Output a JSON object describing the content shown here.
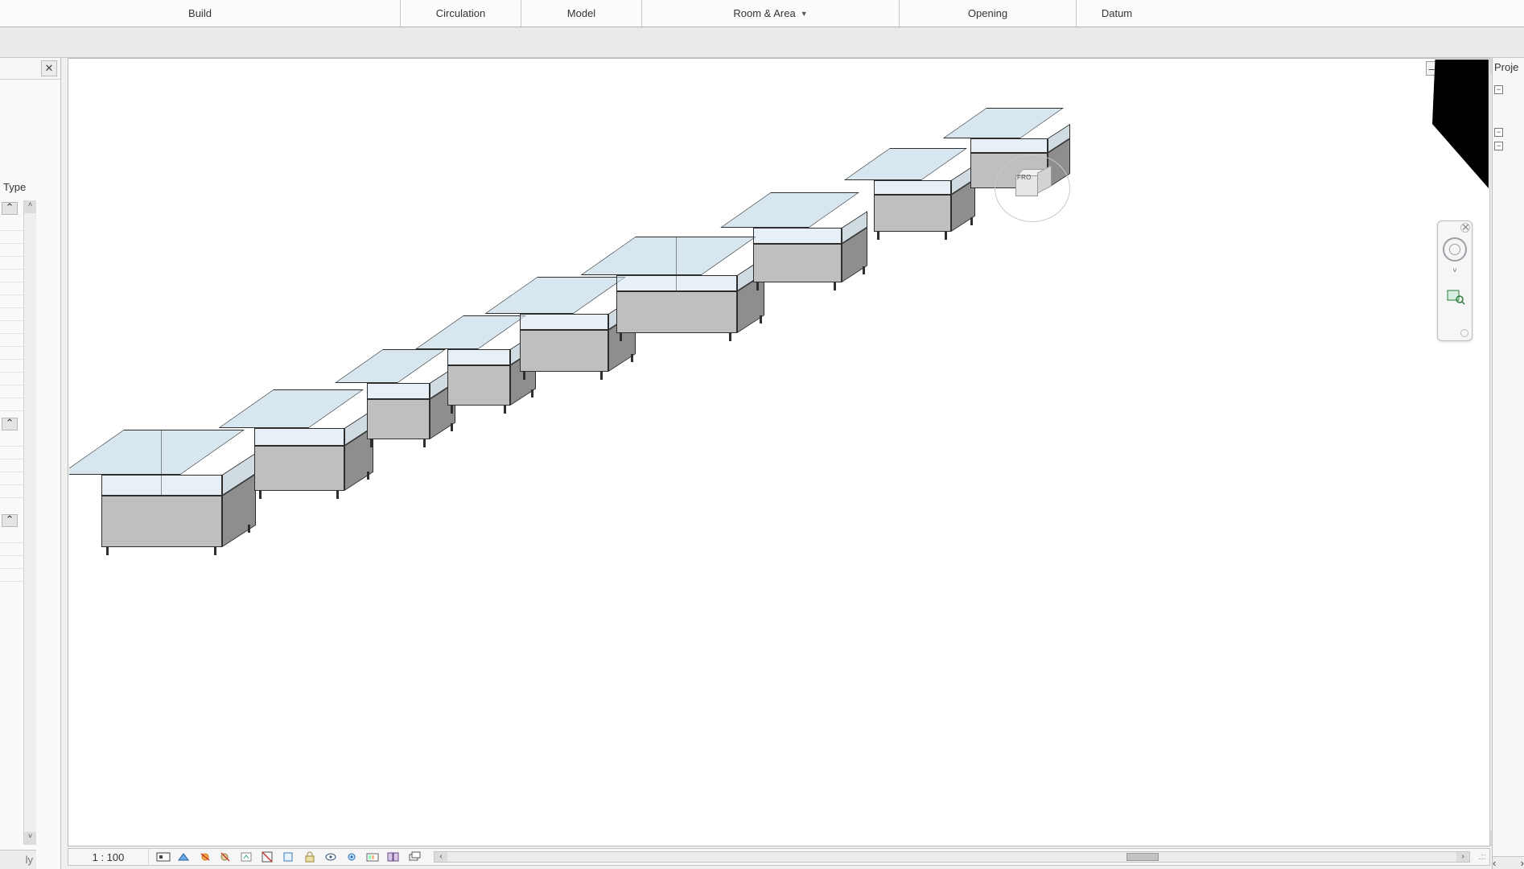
{
  "ribbon": {
    "tabs": [
      "Build",
      "Circulation",
      "Model",
      "Room & Area",
      "Opening",
      "Datum"
    ],
    "dropdown_index": 3
  },
  "properties_panel": {
    "edit_type_label": "Type",
    "apply_label": "ly"
  },
  "project_browser": {
    "title": "Proje"
  },
  "view_bar": {
    "scale": "1 : 100"
  },
  "viewcube": {
    "face_label": "FRO"
  },
  "icons": {
    "close": "✕",
    "minimize": "—",
    "restore": "❐",
    "chevron_up": "˄",
    "chevron_down": "˅",
    "chevron_left": "‹",
    "chevron_right": "›",
    "expand": "⌃",
    "plus": "+",
    "minus": "−",
    "grip": ".::"
  }
}
